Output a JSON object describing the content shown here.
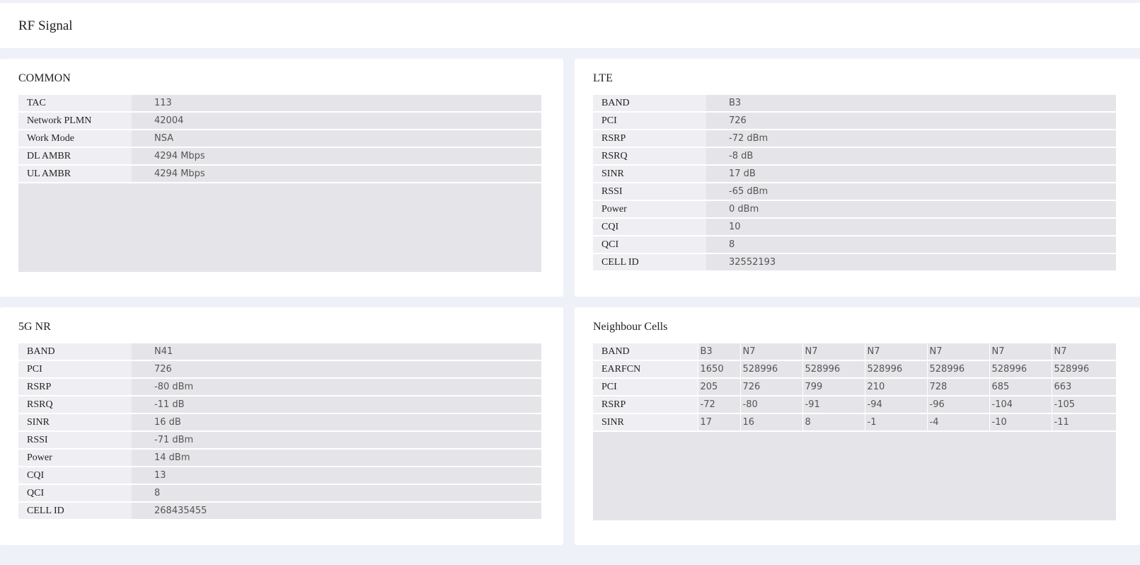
{
  "page": {
    "title": "RF Signal"
  },
  "common": {
    "title": "COMMON",
    "rows": [
      {
        "label": "TAC",
        "value": "113"
      },
      {
        "label": "Network PLMN",
        "value": "42004"
      },
      {
        "label": "Work Mode",
        "value": "NSA"
      },
      {
        "label": "DL AMBR",
        "value": "4294 Mbps"
      },
      {
        "label": "UL AMBR",
        "value": "4294 Mbps"
      }
    ]
  },
  "lte": {
    "title": "LTE",
    "rows": [
      {
        "label": "BAND",
        "value": "B3"
      },
      {
        "label": "PCI",
        "value": "726"
      },
      {
        "label": "RSRP",
        "value": "-72 dBm"
      },
      {
        "label": "RSRQ",
        "value": "-8 dB"
      },
      {
        "label": "SINR",
        "value": "17 dB"
      },
      {
        "label": "RSSI",
        "value": "-65 dBm"
      },
      {
        "label": "Power",
        "value": "0 dBm"
      },
      {
        "label": "CQI",
        "value": "10"
      },
      {
        "label": "QCI",
        "value": "8"
      },
      {
        "label": "CELL ID",
        "value": "32552193"
      }
    ]
  },
  "nr": {
    "title": "5G NR",
    "rows": [
      {
        "label": "BAND",
        "value": "N41"
      },
      {
        "label": "PCI",
        "value": "726"
      },
      {
        "label": "RSRP",
        "value": "-80 dBm"
      },
      {
        "label": "RSRQ",
        "value": "-11 dB"
      },
      {
        "label": "SINR",
        "value": "16 dB"
      },
      {
        "label": "RSSI",
        "value": "-71 dBm"
      },
      {
        "label": "Power",
        "value": "14 dBm"
      },
      {
        "label": "CQI",
        "value": "13"
      },
      {
        "label": "QCI",
        "value": "8"
      },
      {
        "label": "CELL ID",
        "value": "268435455"
      }
    ]
  },
  "neighbour": {
    "title": "Neighbour Cells",
    "rows": [
      {
        "label": "BAND",
        "cells": [
          "B3",
          "N7",
          "N7",
          "N7",
          "N7",
          "N7",
          "N7"
        ]
      },
      {
        "label": "EARFCN",
        "cells": [
          "1650",
          "528996",
          "528996",
          "528996",
          "528996",
          "528996",
          "528996"
        ]
      },
      {
        "label": "PCI",
        "cells": [
          "205",
          "726",
          "799",
          "210",
          "728",
          "685",
          "663"
        ]
      },
      {
        "label": "RSRP",
        "cells": [
          "-72",
          "-80",
          "-91",
          "-94",
          "-96",
          "-104",
          "-105"
        ]
      },
      {
        "label": "SINR",
        "cells": [
          "17",
          "16",
          "8",
          "-1",
          "-4",
          "-10",
          "-11"
        ]
      }
    ]
  }
}
